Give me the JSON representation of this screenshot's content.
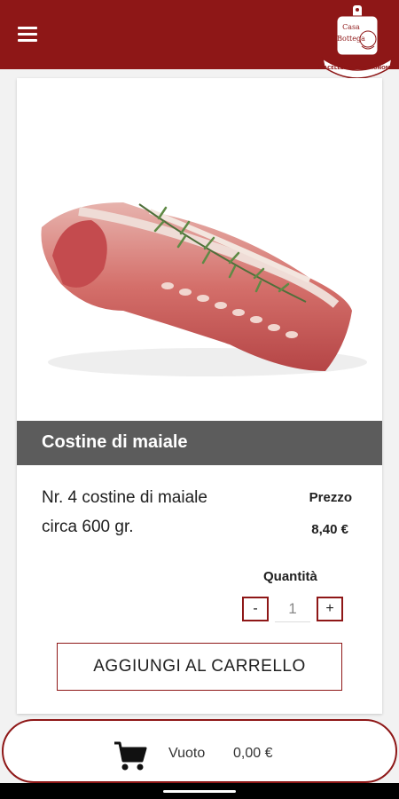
{
  "header": {
    "menu_icon": "hamburger-menu-icon",
    "logo": {
      "line1": "Casa",
      "line2": "Bottega",
      "ribbon": "MACELLERIA GASTRONOMIA"
    },
    "brand_color": "#8e1717"
  },
  "product": {
    "title": "Costine di maiale",
    "description_line1": "Nr. 4 costine di maiale",
    "description_line2": "circa 600 gr.",
    "price_label": "Prezzo",
    "price": "8,40 €",
    "quantity_label": "Quantità",
    "quantity": "1",
    "minus_label": "-",
    "plus_label": "+",
    "add_to_cart_label": "AGGIUNGI AL CARRELLO"
  },
  "cart": {
    "icon": "shopping-cart-icon",
    "status": "Vuoto",
    "total": "0,00 €"
  }
}
